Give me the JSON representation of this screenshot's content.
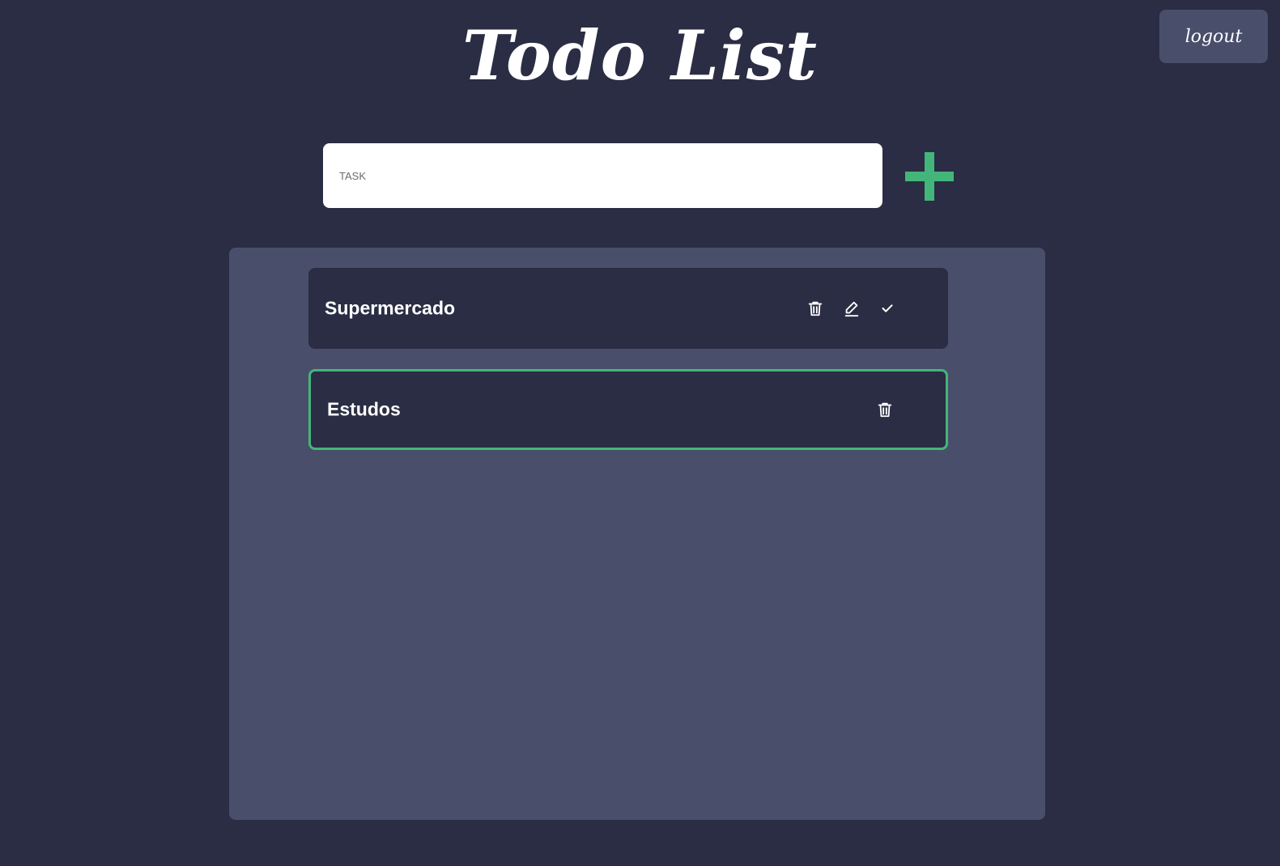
{
  "header": {
    "title": "Todo List",
    "logout_label": "logout"
  },
  "composer": {
    "placeholder": "TASK",
    "value": "",
    "add_icon": "plus-icon",
    "accent_color": "#44b57a"
  },
  "tasks": [
    {
      "label": "Supermercado",
      "completed": false,
      "actions": [
        "trash-icon",
        "pencil-icon",
        "check-icon"
      ]
    },
    {
      "label": "Estudos",
      "completed": true,
      "actions": [
        "trash-icon"
      ]
    }
  ],
  "colors": {
    "background": "#2a2d43",
    "panel": "#494e6b",
    "completed_border": "#44b57a",
    "text": "#ffffff"
  }
}
